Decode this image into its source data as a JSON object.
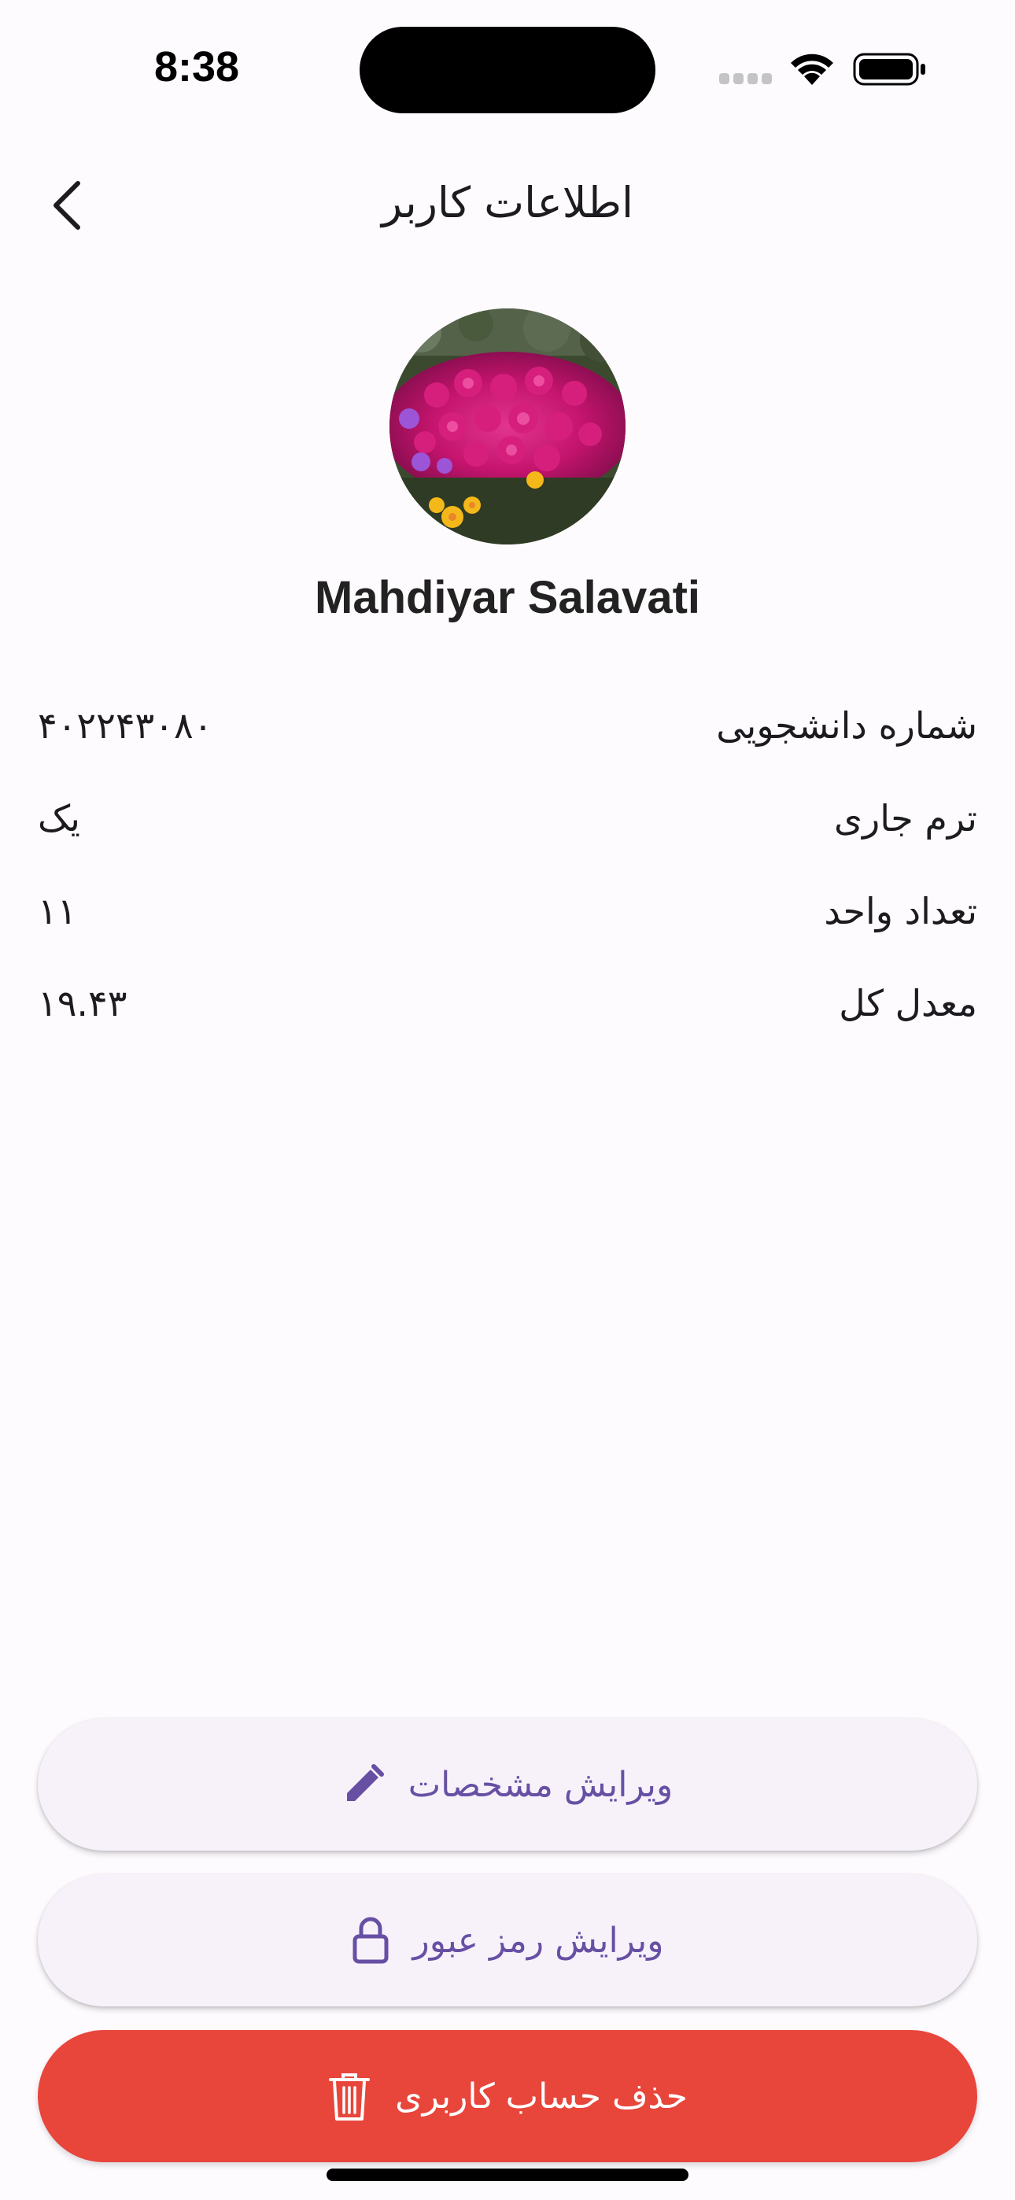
{
  "status_bar": {
    "time": "8:38"
  },
  "app_bar": {
    "title": "اطلاعات کاربر",
    "back_icon": "chevron-left-icon"
  },
  "profile": {
    "name": "Mahdiyar Salavati",
    "avatar_description_icon": "flower-photo"
  },
  "info": [
    {
      "label": "شماره دانشجویی",
      "value": "۴۰۲۲۴۳۰۸۰"
    },
    {
      "label": "ترم جاری",
      "value": "یک"
    },
    {
      "label": "تعداد واحد",
      "value": "۱۱"
    },
    {
      "label": "معدل کل",
      "value": "۱۹.۴۳"
    }
  ],
  "actions": {
    "edit_profile": {
      "label": "ویرایش مشخصات",
      "icon": "pencil-icon"
    },
    "edit_password": {
      "label": "ویرایش رمز عبور",
      "icon": "lock-icon"
    },
    "delete_account": {
      "label": "حذف حساب کاربری",
      "icon": "trash-icon"
    }
  },
  "colors": {
    "accent": "#6750a4",
    "danger": "#e8453b",
    "secondary_button_bg": "#f7f2fa",
    "background": "#fefbff"
  }
}
